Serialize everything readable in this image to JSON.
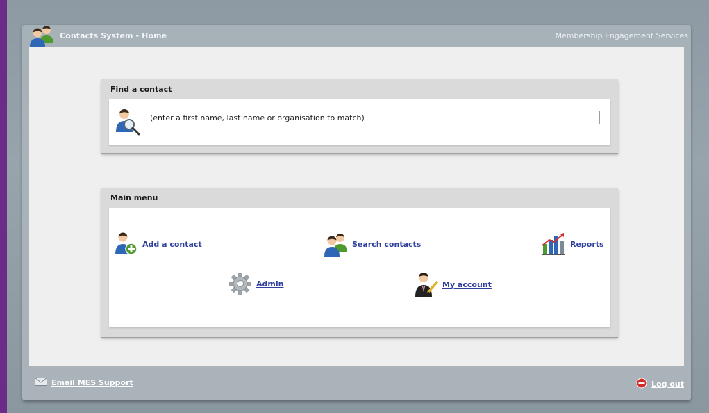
{
  "header": {
    "title": "Contacts System - Home",
    "organization": "Membership Engagement Services"
  },
  "find": {
    "heading": "Find a contact",
    "placeholder": "(enter a first name, last name or organisation to match)"
  },
  "menu": {
    "heading": "Main menu",
    "items": {
      "add_contact": "Add a contact",
      "search_contacts": "Search contacts",
      "reports": "Reports",
      "admin": "Admin",
      "my_account": "My account"
    }
  },
  "footer": {
    "email_support": "Email MES Support",
    "logout": "Log out"
  },
  "colors": {
    "background": "#6a2c86",
    "frame": "#98a4ac",
    "link": "#2f3f9e",
    "logout_red": "#d42a2a"
  },
  "icons": {
    "app_logo": "users-icon",
    "find": "user-search-icon",
    "add_contact": "user-add-icon",
    "search_contacts": "users-icon",
    "reports": "bar-chart-icon",
    "admin": "gear-icon",
    "my_account": "user-edit-icon",
    "email": "envelope-icon",
    "logout": "stop-icon"
  }
}
